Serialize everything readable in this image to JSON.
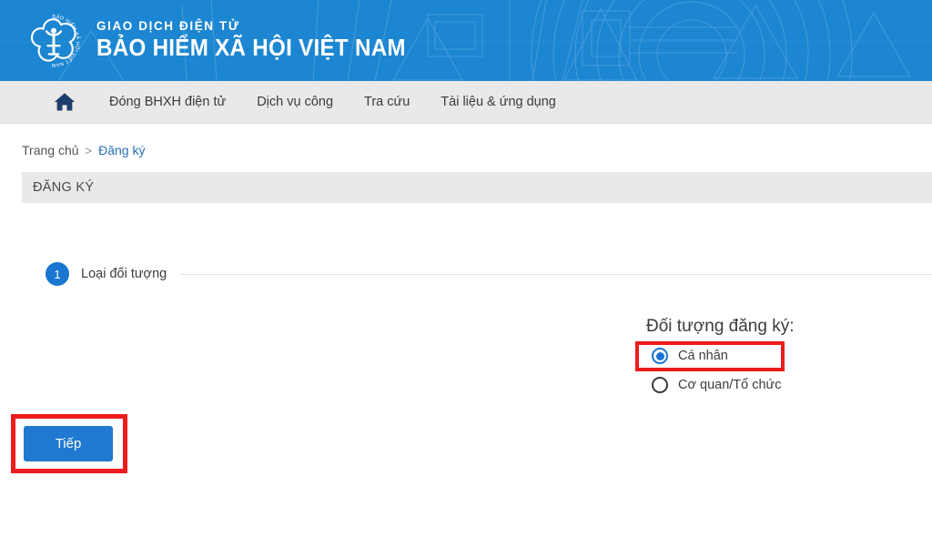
{
  "header": {
    "logo_icon": "bhxh-lotus-emblem-icon",
    "logo_ring_text": "BẢO HIỂM XÃ HỘI VIỆT NAM",
    "tagline": "GIAO DỊCH ĐIỆN TỬ",
    "title": "BẢO HIỂM XÃ HỘI VIỆT NAM",
    "background_color": "#1c86d2"
  },
  "nav": {
    "home_icon": "home-icon",
    "items": [
      {
        "label": "Đóng BHXH điện tử"
      },
      {
        "label": "Dịch vụ công"
      },
      {
        "label": "Tra cứu"
      },
      {
        "label": "Tài liệu & ứng dụng"
      }
    ],
    "background_color": "#e9e9e9"
  },
  "breadcrumb": {
    "home": "Trang chủ",
    "separator": ">",
    "current": "Đăng ký",
    "link_color": "#2a6fb5"
  },
  "page": {
    "title": "ĐĂNG KÝ",
    "title_bar_color": "#e8e9ea"
  },
  "step": {
    "number": "1",
    "label": "Loại đối tượng",
    "badge_color": "#1976d2"
  },
  "form": {
    "object_heading": "Đối tượng đăng ký:",
    "options": [
      {
        "label": "Cá nhân",
        "selected": true
      },
      {
        "label": "Cơ quan/Tổ chức",
        "selected": false
      }
    ],
    "selected_value": "Cá nhân",
    "radio_on_color": "#1a73d4",
    "radio_off_color": "#3a3a3a"
  },
  "actions": {
    "next_label": "Tiếp",
    "next_color": "#1f79d0"
  },
  "annotations": {
    "highlight_color": "#ee1c1c",
    "boxes": [
      {
        "target": "Cá nhân"
      },
      {
        "target": "Tiếp"
      }
    ]
  }
}
